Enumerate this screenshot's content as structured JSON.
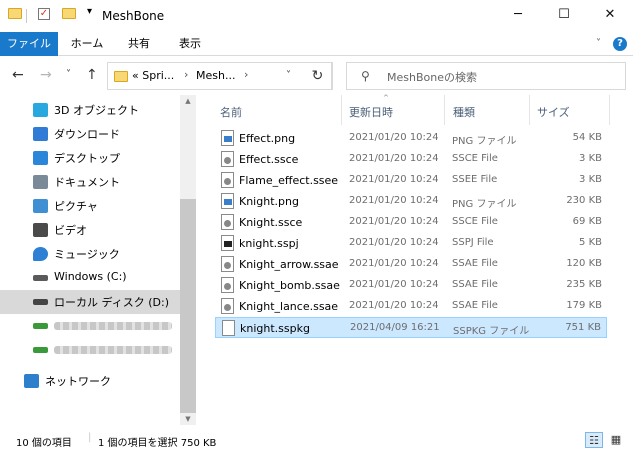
{
  "window": {
    "title": "MeshBone",
    "minimize_glyph": "─",
    "maximize_glyph": "☐",
    "close_glyph": "✕",
    "qa_drop_glyph": "▾"
  },
  "ribbon": {
    "tabs": [
      "ファイル",
      "ホーム",
      "共有",
      "表示"
    ],
    "collapse_glyph": "˅",
    "help_glyph": "?"
  },
  "address": {
    "back_glyph": "←",
    "forward_glyph": "→",
    "recent_glyph": "˅",
    "up_glyph": "↑",
    "crumbs": [
      "« Spri...",
      "Mesh..."
    ],
    "crumb_sep": "›",
    "dropdown_glyph": "˅",
    "refresh_glyph": "↻",
    "search_placeholder": "MeshBoneの検索",
    "search_glyph": "⚲"
  },
  "nav": {
    "items": [
      {
        "label": "3D オブジェクト",
        "icon": "3d-objects-icon",
        "color": "#29a8e0"
      },
      {
        "label": "ダウンロード",
        "icon": "download-icon",
        "color": "#2f7bd6"
      },
      {
        "label": "デスクトップ",
        "icon": "desktop-icon",
        "color": "#2b86d9"
      },
      {
        "label": "ドキュメント",
        "icon": "documents-icon",
        "color": "#7a8a99"
      },
      {
        "label": "ピクチャ",
        "icon": "pictures-icon",
        "color": "#3f8fd2"
      },
      {
        "label": "ビデオ",
        "icon": "videos-icon",
        "color": "#4a4a4a"
      },
      {
        "label": "ミュージック",
        "icon": "music-icon",
        "color": "#2d80d4"
      },
      {
        "label": "Windows (C:)",
        "icon": "drive-windows-icon",
        "color": "#5a5a5a"
      },
      {
        "label": "ローカル ディスク (D:)",
        "icon": "drive-icon",
        "color": "#444444",
        "selected": true
      },
      {
        "label": "",
        "icon": "network-drive-icon",
        "color": "#3a9a3a"
      },
      {
        "label": "",
        "icon": "network-drive-icon",
        "color": "#3a9a3a"
      },
      {
        "label": "ネットワーク",
        "icon": "network-icon",
        "color": "#2d7fcc"
      }
    ],
    "scroll_up_glyph": "▲",
    "scroll_down_glyph": "▼"
  },
  "columns": {
    "name": "名前",
    "date": "更新日時",
    "type": "種類",
    "size": "サイズ",
    "sort_glyph": "^"
  },
  "files": [
    {
      "name": "Effect.png",
      "date": "2021/01/20 10:24",
      "type": "PNG ファイル",
      "size": "54 KB",
      "kind": "image"
    },
    {
      "name": "Effect.ssce",
      "date": "2021/01/20 10:24",
      "type": "SSCE File",
      "size": "3 KB",
      "kind": "gear"
    },
    {
      "name": "Flame_effect.ssee",
      "date": "2021/01/20 10:24",
      "type": "SSEE File",
      "size": "3 KB",
      "kind": "gear"
    },
    {
      "name": "Knight.png",
      "date": "2021/01/20 10:24",
      "type": "PNG ファイル",
      "size": "230 KB",
      "kind": "image"
    },
    {
      "name": "Knight.ssce",
      "date": "2021/01/20 10:24",
      "type": "SSCE File",
      "size": "69 KB",
      "kind": "gear"
    },
    {
      "name": "knight.sspj",
      "date": "2021/01/20 10:24",
      "type": "SSPJ File",
      "size": "5 KB",
      "kind": "project"
    },
    {
      "name": "Knight_arrow.ssae",
      "date": "2021/01/20 10:24",
      "type": "SSAE File",
      "size": "120 KB",
      "kind": "gear"
    },
    {
      "name": "Knight_bomb.ssae",
      "date": "2021/01/20 10:24",
      "type": "SSAE File",
      "size": "235 KB",
      "kind": "gear"
    },
    {
      "name": "Knight_lance.ssae",
      "date": "2021/01/20 10:24",
      "type": "SSAE File",
      "size": "179 KB",
      "kind": "gear"
    },
    {
      "name": "knight.sspkg",
      "date": "2021/04/09 16:21",
      "type": "SSPKG ファイル",
      "size": "751 KB",
      "kind": "blank",
      "selected": true
    }
  ],
  "status": {
    "count": "10 個の項目",
    "selection": "1 個の項目を選択  750 KB"
  },
  "views": {
    "details_glyph": "☷",
    "tiles_glyph": "▦"
  },
  "colors": {
    "accent": "#1979ca",
    "selection_bg": "#cce8ff",
    "selection_border": "#99d1ff"
  }
}
